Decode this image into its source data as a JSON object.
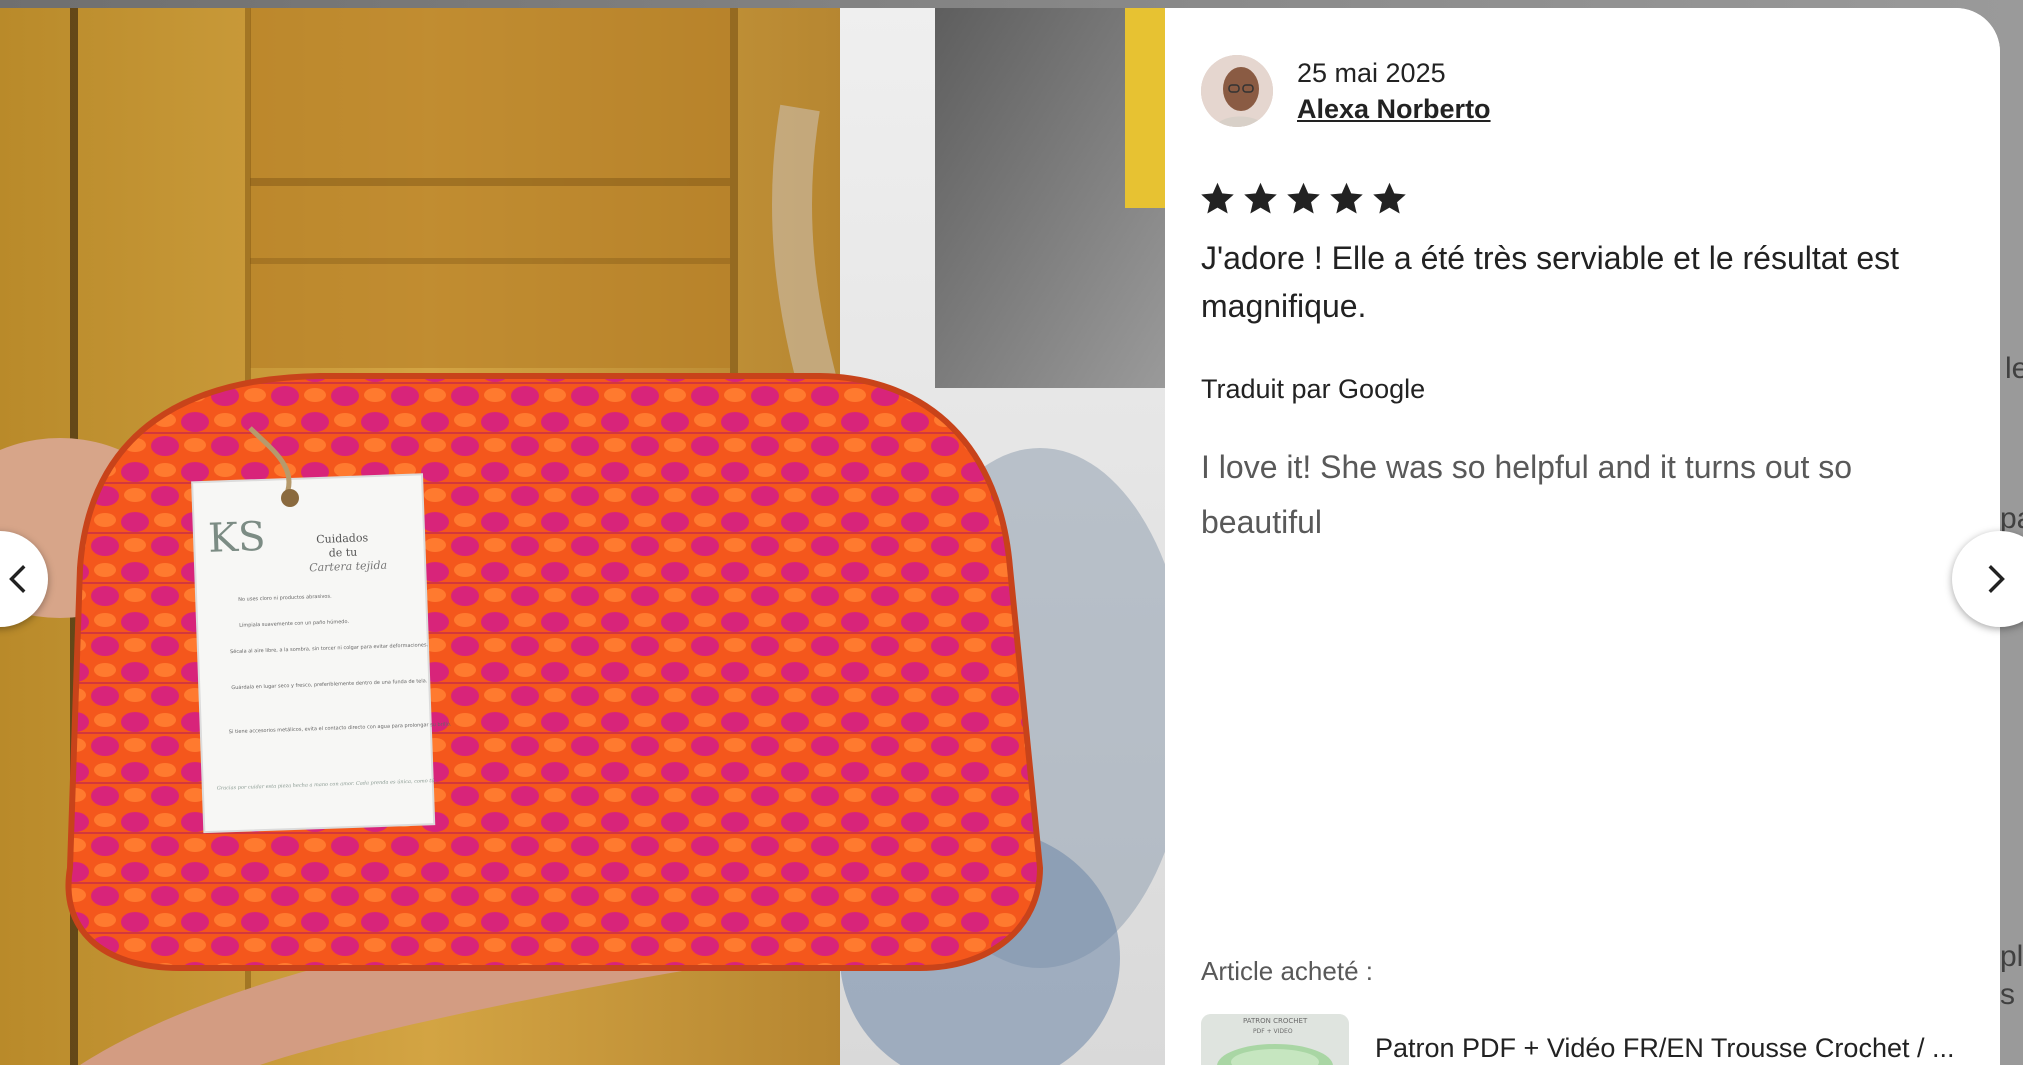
{
  "backdrop": {
    "fragments": [
      "le",
      "pa",
      "plè",
      "s"
    ]
  },
  "review": {
    "date": "25 mai 2025",
    "reviewer_name": "Alexa Norberto",
    "rating": 5,
    "text": "J'adore ! Elle a été très serviable et le résultat est magnifique.",
    "translated_by": "Traduit par Google",
    "translated_text": "I love it! She was so helpful and it turns out so beautiful"
  },
  "purchase": {
    "label": "Article acheté :",
    "title": "Patron PDF + Vidéo FR/EN Trousse Crochet / ...",
    "thumb_caption": "PATRON CROCHET",
    "thumb_subcaption": "PDF + VIDEO"
  },
  "photo_tag": {
    "logo": "KS",
    "title_line1": "Cuidados",
    "title_line2": "de tu",
    "title_line3": "Cartera tejida",
    "items": [
      "No uses cloro ni productos abrasivos.",
      "Límpiala suavemente con un paño húmedo.",
      "Sécala al aire libre, a la sombra, sin torcer ni colgar para evitar deformaciones.",
      "Guárdala en lugar seco y fresco, preferiblemente dentro de una funda de tela.",
      "Si tiene accesorios metálicos, evita el contacto directo con agua para prolongar su brillo."
    ],
    "footer": "Gracias por cuidar esta pieza hecha a mano con amor. Cada prenda es única, como tú."
  },
  "icons": {
    "prev": "chevron-left-icon",
    "next": "chevron-right-icon",
    "star": "star-icon"
  },
  "colors": {
    "text_primary": "#222222",
    "text_secondary": "#595959",
    "star": "#222222",
    "bag_orange": "#f4571c",
    "bag_pink": "#d8247a"
  }
}
